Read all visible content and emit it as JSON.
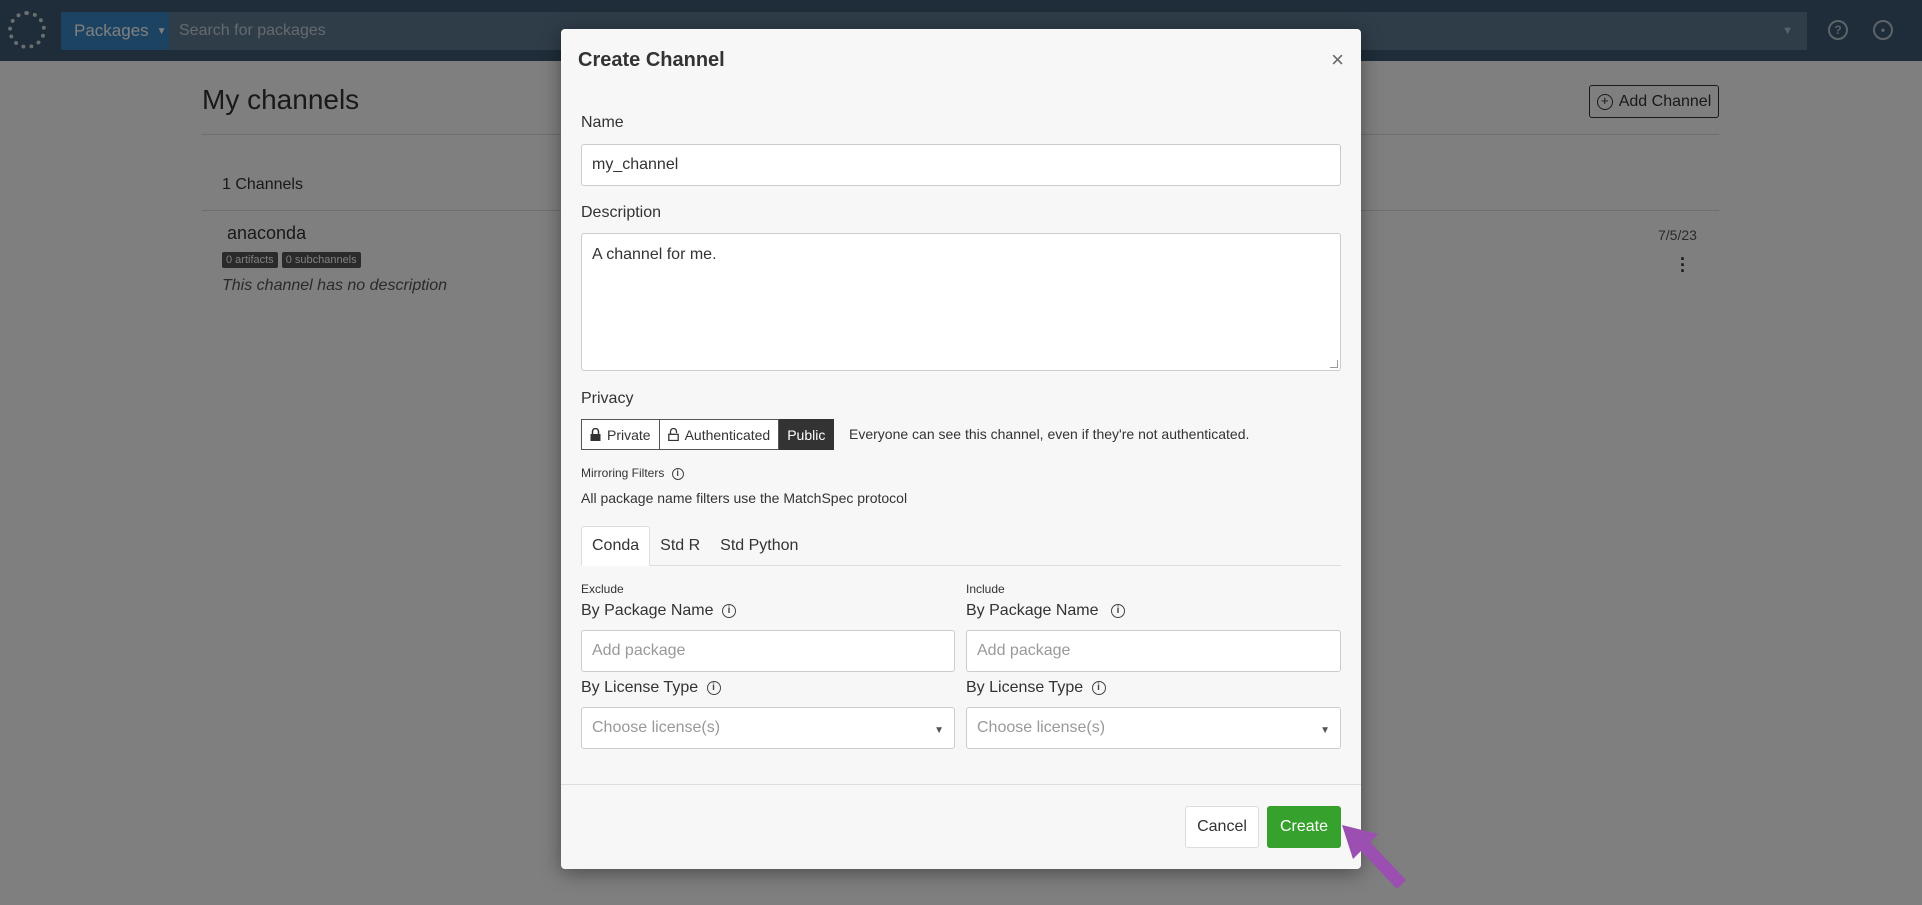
{
  "topbar": {
    "packages_label": "Packages",
    "search_placeholder": "Search for packages"
  },
  "page": {
    "title": "My channels",
    "add_channel_label": "Add Channel",
    "channel_count": "1 Channels",
    "channel": {
      "name": "anaconda",
      "artifacts_badge": "0 artifacts",
      "subchannels_badge": "0 subchannels",
      "description": "This channel has no description",
      "date": "7/5/23"
    }
  },
  "modal": {
    "title": "Create Channel",
    "name_label": "Name",
    "name_value": "my_channel",
    "description_label": "Description",
    "description_value": "A channel for me.",
    "privacy_label": "Privacy",
    "privacy_options": [
      "Private",
      "Authenticated",
      "Public"
    ],
    "privacy_selected": "Public",
    "privacy_note": "Everyone can see this channel, even if they're not authenticated.",
    "mirroring_label": "Mirroring Filters",
    "mirroring_note": "All package name filters use the MatchSpec protocol",
    "tabs": [
      "Conda",
      "Std R",
      "Std Python"
    ],
    "active_tab": "Conda",
    "exclude": {
      "heading": "Exclude",
      "by_package_label": "By Package Name",
      "package_placeholder": "Add package",
      "by_license_label": "By License Type",
      "license_placeholder": "Choose license(s)"
    },
    "include": {
      "heading": "Include",
      "by_package_label": "By Package Name",
      "package_placeholder": "Add package",
      "by_license_label": "By License Type",
      "license_placeholder": "Choose license(s)"
    },
    "cancel_label": "Cancel",
    "create_label": "Create"
  },
  "colors": {
    "topbar": "#3d5a73",
    "packages_button": "#3a86c4",
    "create_button": "#36a22d",
    "annotation_arrow": "#9b4fb0"
  }
}
